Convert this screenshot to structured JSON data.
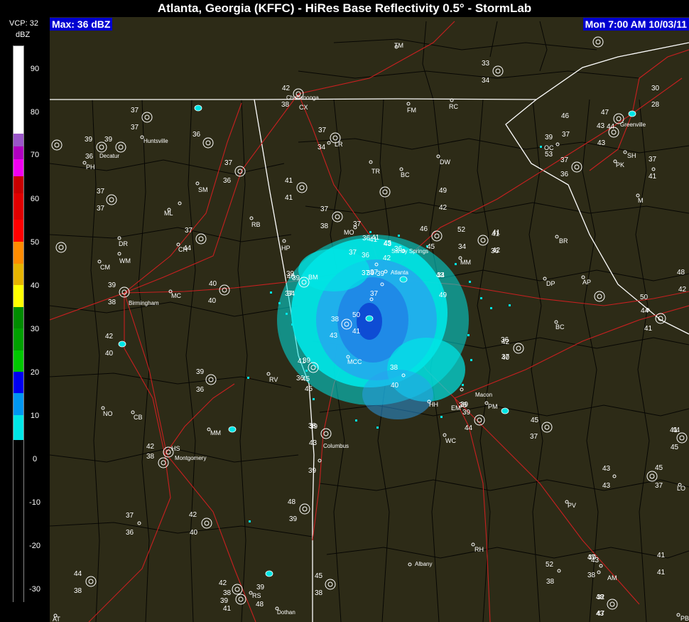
{
  "title": "Atlanta, Georgia (KFFC) - HiRes Base Reflectivity 0.5° - StormLab",
  "max_label": "Max: 36 dBZ",
  "timestamp": "Mon 7:00 AM 10/03/11",
  "legend": {
    "vcp": "VCP: 32",
    "unit": "dBZ",
    "ticks": [
      "90",
      "80",
      "70",
      "60",
      "50",
      "40",
      "30",
      "20",
      "10",
      "0",
      "-10",
      "-20",
      "-30"
    ],
    "colors": {
      "white": "#ffffff",
      "purple": "#9a56c8",
      "magenta": "#f000f0",
      "darkred": "#c80000",
      "red": "#ff0000",
      "orange": "#ff8c00",
      "gold": "#e6b400",
      "yellow": "#ffff00",
      "darkgreen": "#008c00",
      "green": "#00c800",
      "lightgreen": "#00ff00",
      "blue": "#0000f0",
      "skyblue": "#0096f0",
      "cyan": "#00e6e6",
      "black": "#000000"
    }
  },
  "map_colors": {
    "land": "#2d2b17",
    "county_line": "#000000",
    "state_line": "#ffffff",
    "road": "#c82020",
    "echo_light": "#00e0e0",
    "echo_mid": "#2aa0f0",
    "echo_core": "#0a3cd0"
  },
  "cities": [
    "Chattanooga",
    "Huntsville",
    "Birmingham",
    "Atlanta",
    "Sandy Springs",
    "Columbus",
    "Montgomery",
    "Macon",
    "Greenville",
    "Albany",
    "Dothan",
    "Decatur"
  ],
  "place_codes": [
    "TM",
    "CX",
    "FM",
    "RC",
    "LR",
    "DW",
    "TR",
    "BC",
    "SM",
    "ML",
    "RB",
    "DR",
    "CH",
    "WM",
    "CM",
    "HP",
    "MO",
    "BM",
    "MC",
    "MM",
    "BR",
    "DP",
    "AP",
    "BC",
    "RV",
    "MCC",
    "HH",
    "EM",
    "PM",
    "WC",
    "NO",
    "CB",
    "MM",
    "HS",
    "PV",
    "RH",
    "AM",
    "RS",
    "PH",
    "OC",
    "SH",
    "PK",
    "M",
    "LO",
    "PB",
    "AT"
  ],
  "station_values": [
    "42",
    "38",
    "37",
    "37",
    "39",
    "39",
    "36",
    "37",
    "36",
    "37",
    "37",
    "36",
    "37",
    "34",
    "41",
    "41",
    "37",
    "38",
    "37",
    "44",
    "37",
    "36",
    "37",
    "41",
    "43",
    "36",
    "41",
    "46",
    "52",
    "34",
    "41",
    "36",
    "37",
    "39",
    "37",
    "43",
    "40",
    "40",
    "42",
    "40",
    "39",
    "38",
    "46",
    "34",
    "34",
    "49",
    "36",
    "45",
    "45",
    "42",
    "39",
    "37",
    "38",
    "43",
    "41",
    "50",
    "38",
    "40",
    "41",
    "36",
    "39",
    "36",
    "39",
    "43",
    "39",
    "38",
    "39",
    "44",
    "42",
    "40",
    "42",
    "38",
    "48",
    "39",
    "37",
    "36",
    "42",
    "40",
    "42",
    "38",
    "39",
    "41",
    "39",
    "48",
    "44",
    "38",
    "52",
    "38",
    "47",
    "38",
    "48",
    "43",
    "41",
    "41",
    "50",
    "44",
    "41",
    "45",
    "37",
    "43",
    "43",
    "45",
    "37",
    "41",
    "45",
    "39",
    "53",
    "33",
    "34",
    "30",
    "28",
    "46",
    "37",
    "47",
    "43",
    "44",
    "43",
    "36",
    "37",
    "37",
    "41",
    "36",
    "37",
    "45",
    "45",
    "39",
    "49",
    "42",
    "41",
    "42",
    "38",
    "39",
    "39",
    "37",
    "39",
    "45",
    "38",
    "39",
    "43",
    "32",
    "47",
    "48",
    "42",
    "44"
  ]
}
